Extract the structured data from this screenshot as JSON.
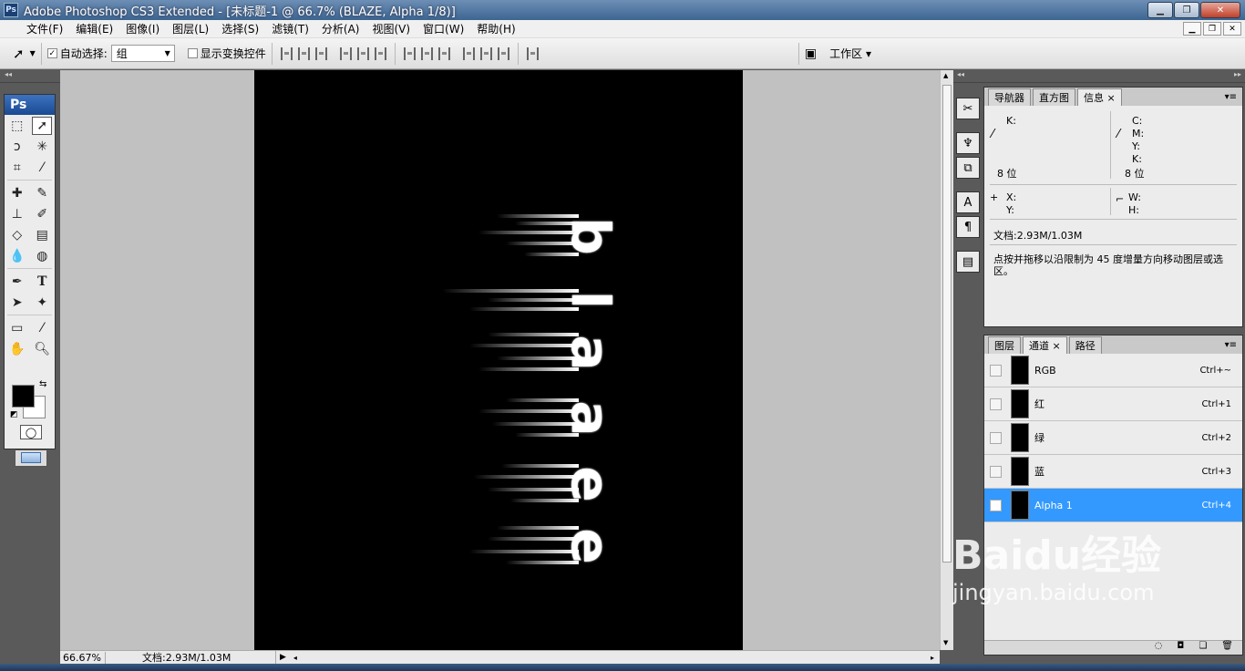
{
  "title": "Adobe Photoshop CS3 Extended - [未标题-1 @ 66.7% (BLAZE, Alpha 1/8)]",
  "app_icon_label": "Ps",
  "window_buttons": {
    "minimize": "▁",
    "maximize": "❐",
    "close": "✕"
  },
  "menu": [
    "文件(F)",
    "编辑(E)",
    "图像(I)",
    "图层(L)",
    "选择(S)",
    "滤镜(T)",
    "分析(A)",
    "视图(V)",
    "窗口(W)",
    "帮助(H)"
  ],
  "options": {
    "auto_select_label": "自动选择:",
    "auto_select_checked": "✓",
    "auto_select_value": "组",
    "show_transform_label": "显示变换控件",
    "workspace_label": "工作区 ▾"
  },
  "toolbox": {
    "logo": "Ps"
  },
  "artwork": {
    "text": "blaze",
    "letters": [
      "b",
      "l",
      "a",
      "z",
      "e"
    ]
  },
  "status": {
    "zoom": "66.67%",
    "doc": "文档:2.93M/1.03M"
  },
  "info_panel": {
    "tabs": [
      "导航器",
      "直方图",
      "信息"
    ],
    "active_tab": "信息",
    "close_mark": "×",
    "k_label": "K:",
    "cmyk_labels": [
      "C:",
      "M:",
      "Y:",
      "K:"
    ],
    "bits_left": "8 位",
    "bits_right": "8 位",
    "x_label": "X:",
    "y_label": "Y:",
    "w_label": "W:",
    "h_label": "H:",
    "doc_size": "文档:2.93M/1.03M",
    "hint": "点按并拖移以沿限制为 45 度增量方向移动图层或选区。"
  },
  "channels_panel": {
    "tabs": [
      "图层",
      "通道",
      "路径"
    ],
    "active_tab": "通道",
    "rows": [
      {
        "name": "RGB",
        "shortcut": "Ctrl+~",
        "selected": false
      },
      {
        "name": "红",
        "shortcut": "Ctrl+1",
        "selected": false
      },
      {
        "name": "绿",
        "shortcut": "Ctrl+2",
        "selected": false
      },
      {
        "name": "蓝",
        "shortcut": "Ctrl+3",
        "selected": false
      },
      {
        "name": "Alpha 1",
        "shortcut": "Ctrl+4",
        "selected": true
      }
    ]
  },
  "watermark": {
    "brand": "Baidu经验",
    "url": "jingyan.baidu.com"
  },
  "colors": {
    "selection": "#3399ff",
    "canvas_bg": "#c1c1c1",
    "ui_dark": "#5a5a5a"
  }
}
